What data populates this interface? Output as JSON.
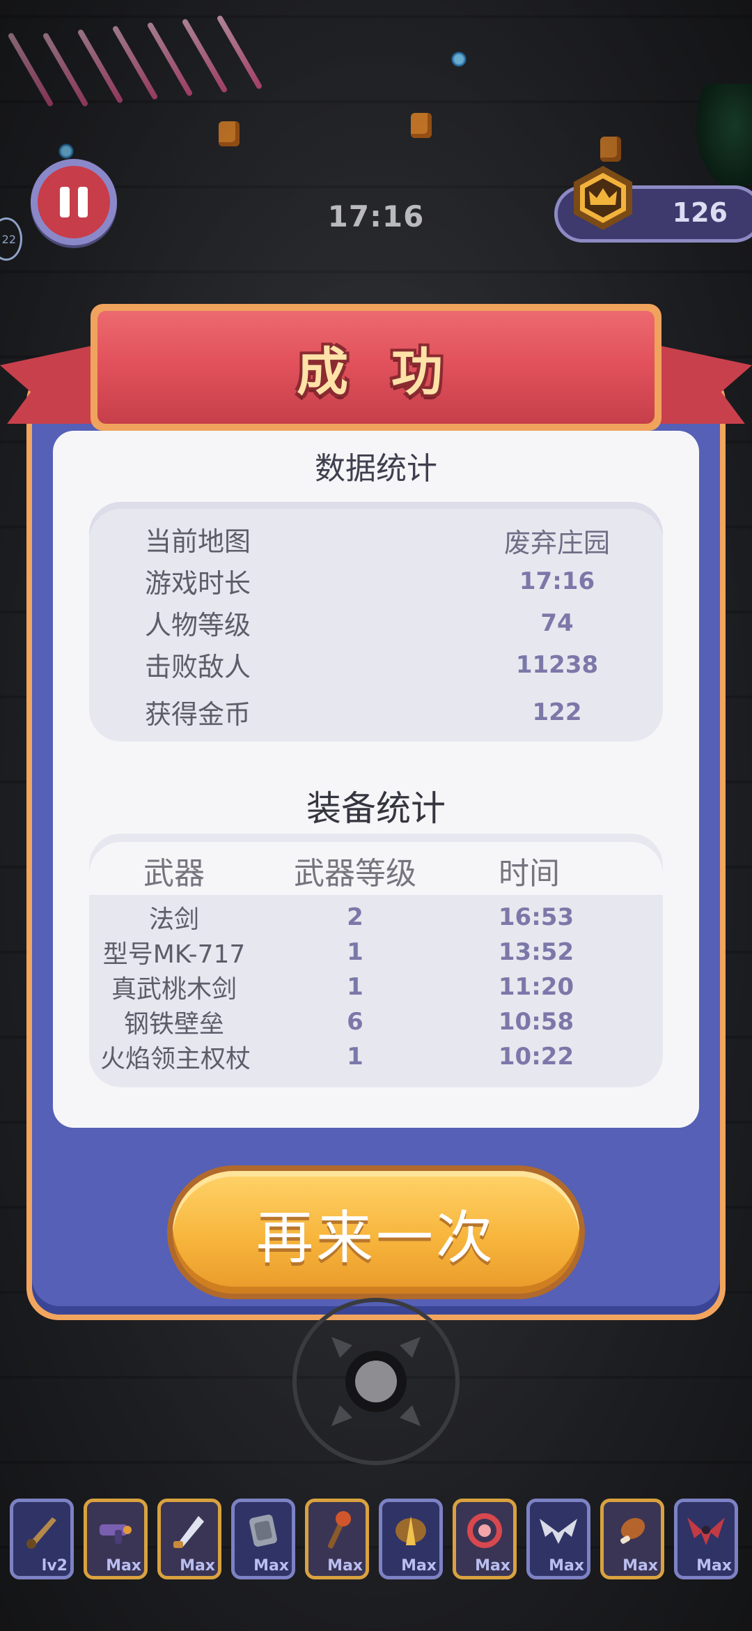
{
  "hud": {
    "timer": "17:16",
    "coins": "126",
    "side_badge": "22"
  },
  "dialog": {
    "title": "成 功",
    "data_section_title": "数据统计",
    "stats": [
      {
        "label": "当前地图",
        "value": "废弃庄园"
      },
      {
        "label": "游戏时长",
        "value": "17:16"
      },
      {
        "label": "人物等级",
        "value": "74"
      },
      {
        "label": "击败敌人",
        "value": "11238"
      },
      {
        "label": "获得金币",
        "value": "122"
      }
    ],
    "equip_section_title": "装备统计",
    "equip_headers": [
      "武器",
      "武器等级",
      "时间"
    ],
    "equipment": [
      {
        "name": "法剑",
        "level": "2",
        "time": "16:53"
      },
      {
        "name": "型号MK-717",
        "level": "1",
        "time": "13:52"
      },
      {
        "name": "真武桃木剑",
        "level": "1",
        "time": "11:20"
      },
      {
        "name": "钢铁壁垒",
        "level": "6",
        "time": "10:58"
      },
      {
        "name": "火焰领主权杖",
        "level": "1",
        "time": "10:22"
      }
    ],
    "retry_label": "再来一次"
  },
  "weapon_slots": [
    {
      "icon": "sword-icon",
      "label": "lv2"
    },
    {
      "icon": "gun-icon",
      "label": "Max"
    },
    {
      "icon": "blade-icon",
      "label": "Max"
    },
    {
      "icon": "shield-icon",
      "label": "Max"
    },
    {
      "icon": "scepter-icon",
      "label": "Max"
    },
    {
      "icon": "wing-blade-icon",
      "label": "Max"
    },
    {
      "icon": "ring-icon",
      "label": "Max"
    },
    {
      "icon": "bat-wings-icon",
      "label": "Max"
    },
    {
      "icon": "meat-icon",
      "label": "Max"
    },
    {
      "icon": "demon-wings-icon",
      "label": "Max"
    }
  ]
}
